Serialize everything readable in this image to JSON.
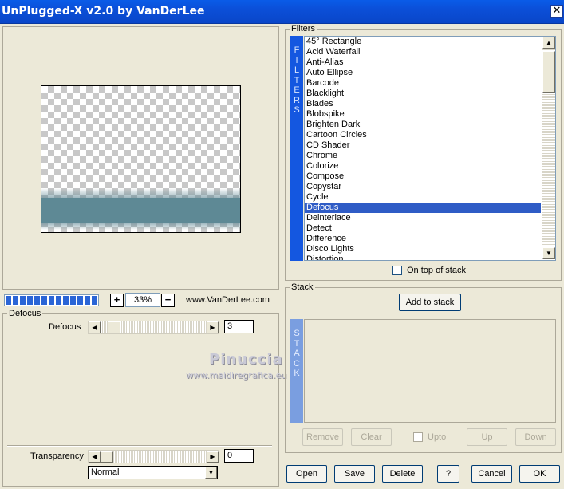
{
  "window": {
    "title": "UnPlugged-X v2.0 by VanDerLee",
    "close_glyph": "✕"
  },
  "zoom": {
    "minus": "−",
    "plus": "+",
    "value": "33%"
  },
  "progress": {
    "fraction": 1.0
  },
  "site_link": "www.VanDerLee.com",
  "defocus_group": {
    "label": "Defocus",
    "param_label": "Defocus",
    "param_value": "3"
  },
  "transparency": {
    "label": "Transparency",
    "value": "0"
  },
  "blend_mode": {
    "selected": "Normal"
  },
  "watermark": {
    "name": "Pinuccia",
    "url": "www.maidiregrafica.eu"
  },
  "filters": {
    "group_label": "Filters",
    "bar_letters": [
      "F",
      "I",
      "L",
      "T",
      "E",
      "R",
      "S"
    ],
    "items": [
      "45° Rectangle",
      "Acid Waterfall",
      "Anti-Alias",
      "Auto Ellipse",
      "Barcode",
      "Blacklight",
      "Blades",
      "Blobspike",
      "Brighten Dark",
      "Cartoon Circles",
      "CD Shader",
      "Chrome",
      "Colorize",
      "Compose",
      "Copystar",
      "Cycle",
      "Defocus",
      "Deinterlace",
      "Detect",
      "Difference",
      "Disco Lights",
      "Distortion"
    ],
    "selected_index": 16,
    "on_top_label": "On top of stack"
  },
  "stack": {
    "group_label": "Stack",
    "add_label": "Add to stack",
    "bar_letters": [
      "S",
      "T",
      "A",
      "C",
      "K"
    ],
    "remove_label": "Remove",
    "clear_label": "Clear",
    "upto_label": "Upto",
    "up_label": "Up",
    "down_label": "Down"
  },
  "bottom_buttons": {
    "open": "Open",
    "save": "Save",
    "delete": "Delete",
    "help": "?",
    "cancel": "Cancel",
    "ok": "OK"
  }
}
